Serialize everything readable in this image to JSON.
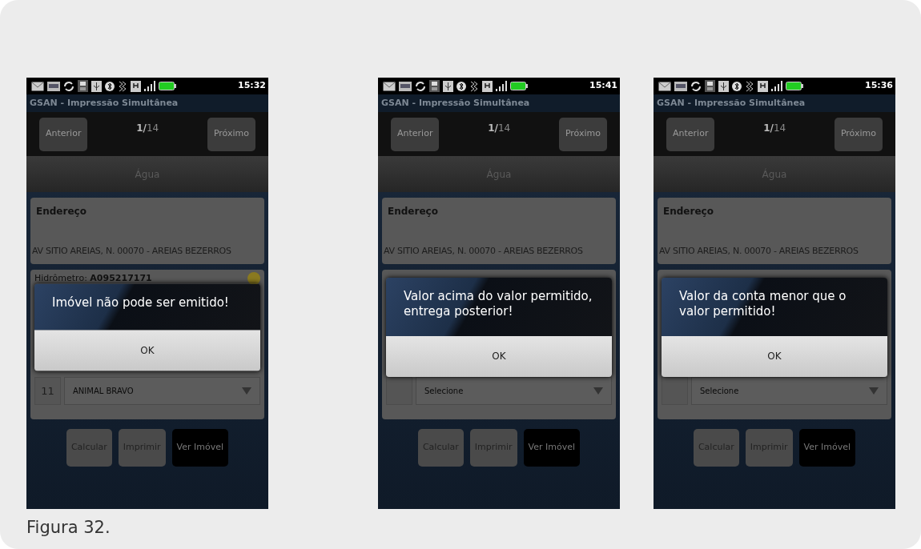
{
  "screens": [
    {
      "status_time": "15:32",
      "app_title": "GSAN - Impressão Simultânea",
      "prev_button": "Anterior",
      "counter": "**1/**14",
      "next_button": "Próximo",
      "tab": "Água",
      "address_label": "Endereço",
      "address": "AV SITIO AREIAS, N. 00070 - AREIAS BEZERROS",
      "meter": "Hidrômetro: **A095217171**",
      "select_code": "11",
      "select_value": "ANIMAL BRAVO",
      "buttons": [
        {
          "label": "Calcular",
          "selected": false
        },
        {
          "label": "Imprimir",
          "selected": false
        },
        {
          "label": "Ver Imóvel",
          "selected": true
        }
      ],
      "dialog": {
        "message": "Imóvel não pode ser emitido!",
        "button": "OK"
      }
    },
    {
      "status_time": "15:41",
      "app_title": "GSAN - Impressão Simultânea",
      "prev_button": "Anterior",
      "counter": "**1/**14",
      "next_button": "Próximo",
      "tab": "Água",
      "address_label": "Endereço",
      "address": "AV SITIO AREIAS, N. 00070 - AREIAS BEZERROS",
      "select_value": "Selecione",
      "buttons": [
        {
          "label": "Calcular",
          "selected": false
        },
        {
          "label": "Imprimir",
          "selected": false
        },
        {
          "label": "Ver Imóvel",
          "selected": true
        }
      ],
      "dialog": {
        "message": "Valor acima do valor permitido, entrega posterior!",
        "button": "OK"
      }
    },
    {
      "status_time": "15:36",
      "app_title": "GSAN - Impressão Simultânea",
      "prev_button": "Anterior",
      "counter": "**1/**14",
      "next_button": "Próximo",
      "tab": "Água",
      "address_label": "Endereço",
      "address": "AV SITIO AREIAS, N. 00070 - AREIAS BEZERROS",
      "select_value": "Selecione",
      "buttons": [
        {
          "label": "Calcular",
          "selected": false
        },
        {
          "label": "Imprimir",
          "selected": false
        },
        {
          "label": "Ver Imóvel",
          "selected": true
        }
      ],
      "dialog": {
        "message": "Valor da conta menor que o valor permitido!",
        "button": "OK"
      }
    }
  ],
  "caption": "Figura 32."
}
